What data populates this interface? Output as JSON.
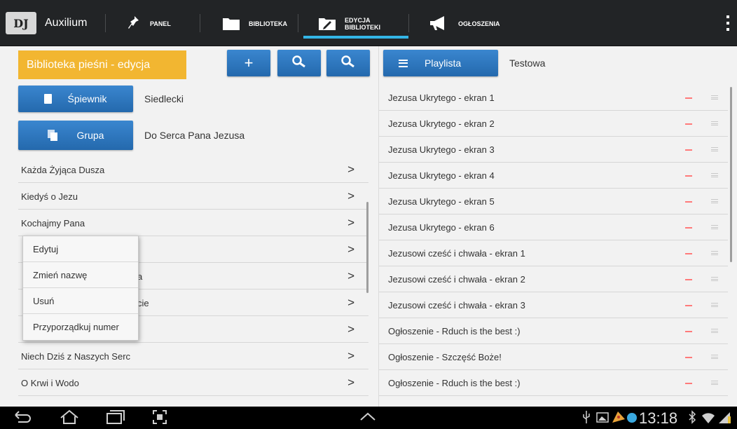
{
  "app": {
    "title": "Auxilium",
    "logo_text": "DJ"
  },
  "tabs": [
    {
      "label": "PANEL",
      "icon": "pin-icon"
    },
    {
      "label": "BIBLIOTEKA",
      "icon": "folder-icon"
    },
    {
      "label": "EDYCJA",
      "label2": "BIBLIOTEKI",
      "icon": "folder-edit-icon",
      "active": true
    },
    {
      "label": "OGŁOSZENIA",
      "icon": "megaphone-icon"
    }
  ],
  "left": {
    "title": "Biblioteka pieśni - edycja",
    "add_label": "+",
    "songbook_button": "Śpiewnik",
    "songbook_value": "Siedlecki",
    "group_button": "Grupa",
    "group_value": "Do Serca Pana Jezusa",
    "chevron": ">",
    "songs": [
      "Każda Żyjąca Dusza",
      "Kiedyś o Jezu",
      "Kochajmy Pana",
      "",
      "a",
      "cie",
      "",
      "Niech Dziś z Naszych Serc",
      "O Krwi i Wodo"
    ]
  },
  "context_menu": {
    "items": [
      "Edytuj",
      "Zmień nazwę",
      "Usuń",
      "Przyporządkuj numer"
    ]
  },
  "right": {
    "playlist_button": "Playlista",
    "playlist_name": "Testowa",
    "items": [
      "Jezusa Ukrytego - ekran 1",
      "Jezusa Ukrytego - ekran 2",
      "Jezusa Ukrytego - ekran 3",
      "Jezusa Ukrytego - ekran 4",
      "Jezusa Ukrytego - ekran 5",
      "Jezusa Ukrytego - ekran 6",
      "Jezusowi cześć i chwała - ekran 1",
      "Jezusowi cześć i chwała - ekran 2",
      "Jezusowi cześć i chwała - ekran 3",
      "Ogłoszenie - Rduch is the best :)",
      "Ogłoszenie - Szczęść Boże!",
      "Ogłoszenie - Rduch is the best :)"
    ]
  },
  "status": {
    "time": "13:18"
  },
  "colors": {
    "accent": "#33b5e5",
    "yellow": "#f2b631",
    "blue": "#2a77c0",
    "remove": "#ff7a7a"
  }
}
